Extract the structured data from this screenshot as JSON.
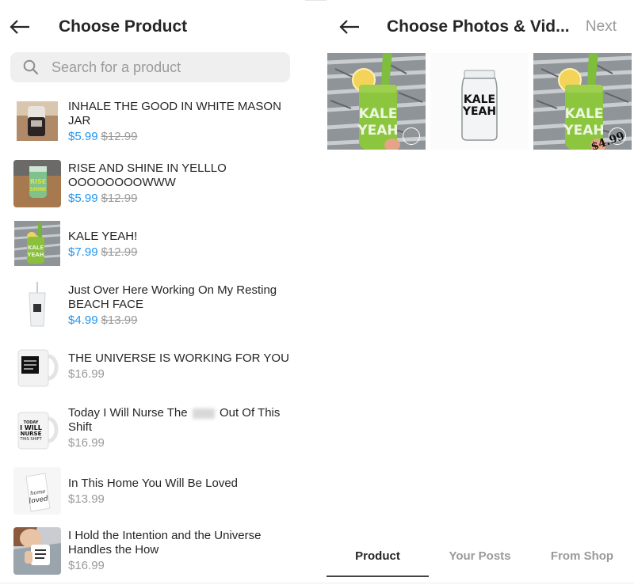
{
  "left_panel": {
    "back_icon": "arrow-left-icon",
    "title": "Choose Product",
    "search": {
      "icon": "search-icon",
      "placeholder": "Search for a product",
      "value": ""
    },
    "products": [
      {
        "name": "INHALE THE GOOD IN WHITE MASON JAR",
        "sale_price": "$5.99",
        "original_price": "$12.99",
        "thumb": "white-mason-jar-photo"
      },
      {
        "name": "RISE AND SHINE IN YELLLOOOOOOOOOWWW",
        "sale_price": "$5.99",
        "original_price": "$12.99",
        "thumb": "green-jar-photo"
      },
      {
        "name": "KALE YEAH!",
        "sale_price": "$7.99",
        "original_price": "$12.99",
        "thumb": "kale-juice-photo"
      },
      {
        "name": "Just Over Here Working On My Resting BEACH FACE",
        "sale_price": "$4.99",
        "original_price": "$13.99",
        "thumb": "tumbler-photo"
      },
      {
        "name": "THE UNIVERSE IS WORKING FOR YOU",
        "price": "$16.99",
        "thumb": "black-print-mug-photo"
      },
      {
        "name_before": "Today I Will Nurse The",
        "name_after": "Out Of This Shift",
        "price": "$16.99",
        "thumb": "nurse-mug-photo"
      },
      {
        "name": "In This Home You Will Be Loved",
        "price": "$13.99",
        "thumb": "tea-towel-photo"
      },
      {
        "name": "I Hold the Intention and the Universe Handles the How",
        "price": "$16.99",
        "thumb": "woman-with-mug-photo"
      }
    ]
  },
  "right_panel": {
    "back_icon": "arrow-left-icon",
    "title": "Choose Photos & Vid...",
    "next_label": "Next",
    "photos": [
      {
        "label": "KALE YEAH",
        "kind": "green-juice-jar",
        "selected": false
      },
      {
        "label": "KALE YEAH",
        "kind": "clear-mason-jar"
      },
      {
        "label": "KALE YEAH",
        "kind": "green-juice-jar",
        "price_stamp": "$4.99",
        "selected": false
      }
    ],
    "tabs": [
      {
        "label": "Product",
        "active": true
      },
      {
        "label": "Your Posts",
        "active": false
      },
      {
        "label": "From Shop",
        "active": false
      }
    ]
  },
  "colors": {
    "sale": "#2196f3",
    "muted": "#9a9a9a",
    "text": "#262626"
  }
}
